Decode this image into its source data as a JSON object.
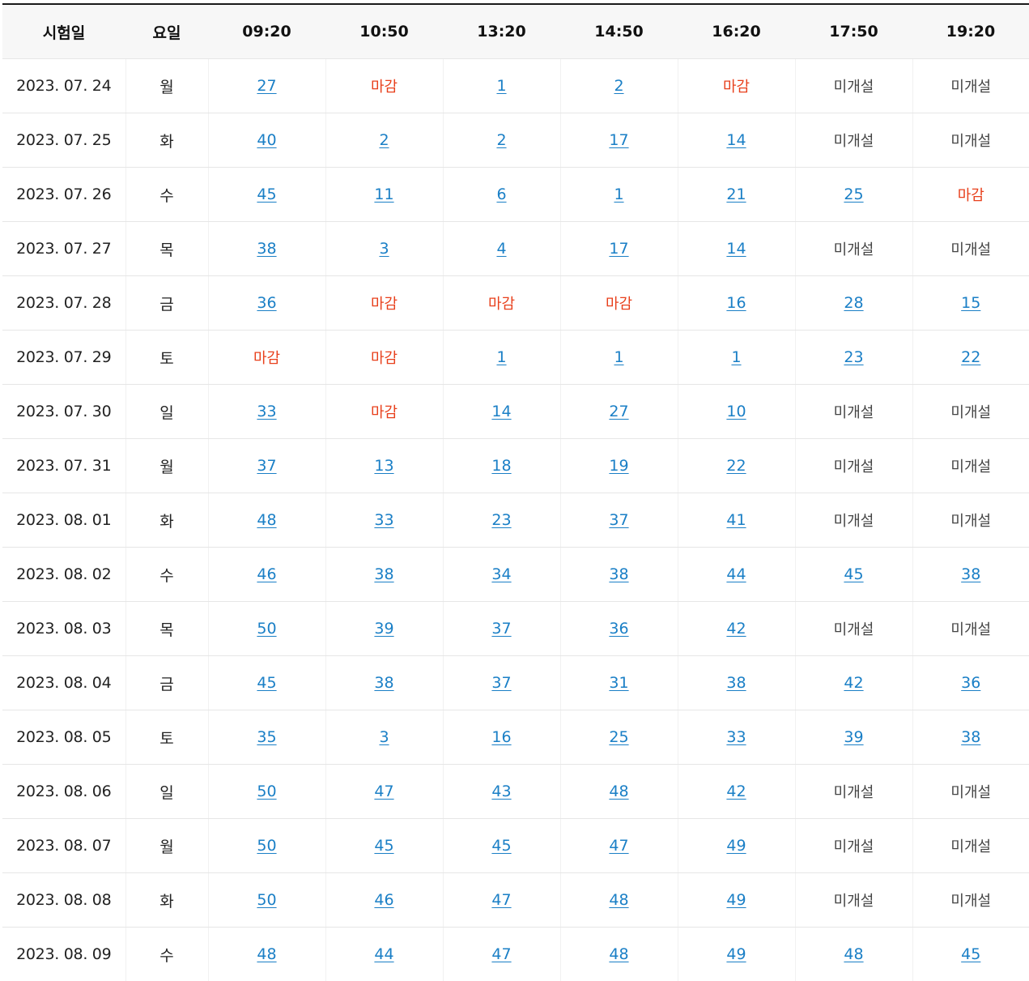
{
  "headers": [
    "시험일",
    "요일",
    "09:20",
    "10:50",
    "13:20",
    "14:50",
    "16:20",
    "17:50",
    "19:20"
  ],
  "status_colors": {
    "link": "#1a7fc6",
    "closed": "#e8401c",
    "unopened": "#444444"
  },
  "rows": [
    {
      "date": "2023. 07. 24",
      "day": "월",
      "slots": [
        "27",
        "마감",
        "1",
        "2",
        "마감",
        "미개설",
        "미개설"
      ]
    },
    {
      "date": "2023. 07. 25",
      "day": "화",
      "slots": [
        "40",
        "2",
        "2",
        "17",
        "14",
        "미개설",
        "미개설"
      ]
    },
    {
      "date": "2023. 07. 26",
      "day": "수",
      "slots": [
        "45",
        "11",
        "6",
        "1",
        "21",
        "25",
        "마감"
      ]
    },
    {
      "date": "2023. 07. 27",
      "day": "목",
      "slots": [
        "38",
        "3",
        "4",
        "17",
        "14",
        "미개설",
        "미개설"
      ]
    },
    {
      "date": "2023. 07. 28",
      "day": "금",
      "slots": [
        "36",
        "마감",
        "마감",
        "마감",
        "16",
        "28",
        "15"
      ]
    },
    {
      "date": "2023. 07. 29",
      "day": "토",
      "slots": [
        "마감",
        "마감",
        "1",
        "1",
        "1",
        "23",
        "22"
      ]
    },
    {
      "date": "2023. 07. 30",
      "day": "일",
      "slots": [
        "33",
        "마감",
        "14",
        "27",
        "10",
        "미개설",
        "미개설"
      ]
    },
    {
      "date": "2023. 07. 31",
      "day": "월",
      "slots": [
        "37",
        "13",
        "18",
        "19",
        "22",
        "미개설",
        "미개설"
      ]
    },
    {
      "date": "2023. 08. 01",
      "day": "화",
      "slots": [
        "48",
        "33",
        "23",
        "37",
        "41",
        "미개설",
        "미개설"
      ]
    },
    {
      "date": "2023. 08. 02",
      "day": "수",
      "slots": [
        "46",
        "38",
        "34",
        "38",
        "44",
        "45",
        "38"
      ]
    },
    {
      "date": "2023. 08. 03",
      "day": "목",
      "slots": [
        "50",
        "39",
        "37",
        "36",
        "42",
        "미개설",
        "미개설"
      ]
    },
    {
      "date": "2023. 08. 04",
      "day": "금",
      "slots": [
        "45",
        "38",
        "37",
        "31",
        "38",
        "42",
        "36"
      ]
    },
    {
      "date": "2023. 08. 05",
      "day": "토",
      "slots": [
        "35",
        "3",
        "16",
        "25",
        "33",
        "39",
        "38"
      ]
    },
    {
      "date": "2023. 08. 06",
      "day": "일",
      "slots": [
        "50",
        "47",
        "43",
        "48",
        "42",
        "미개설",
        "미개설"
      ]
    },
    {
      "date": "2023. 08. 07",
      "day": "월",
      "slots": [
        "50",
        "45",
        "45",
        "47",
        "49",
        "미개설",
        "미개설"
      ]
    },
    {
      "date": "2023. 08. 08",
      "day": "화",
      "slots": [
        "50",
        "46",
        "47",
        "48",
        "49",
        "미개설",
        "미개설"
      ]
    },
    {
      "date": "2023. 08. 09",
      "day": "수",
      "slots": [
        "48",
        "44",
        "47",
        "48",
        "49",
        "48",
        "45"
      ]
    }
  ]
}
